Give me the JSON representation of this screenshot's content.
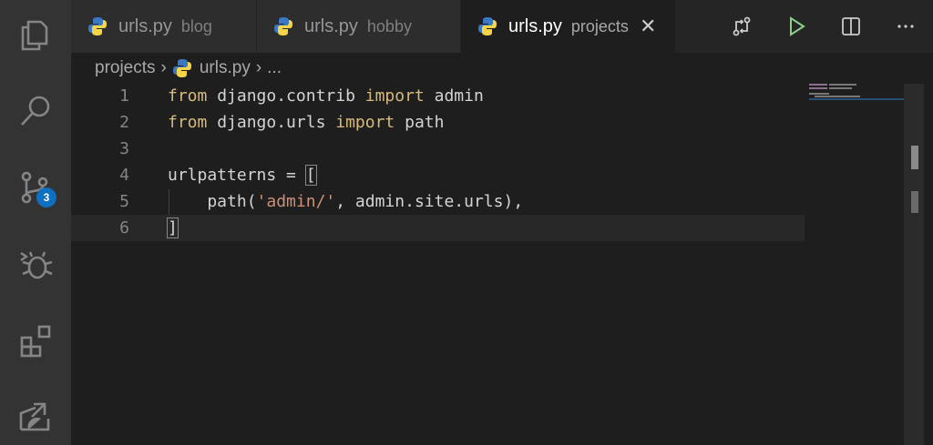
{
  "activity_bar": {
    "scm_badge": "3"
  },
  "tabs": [
    {
      "name": "urls.py",
      "desc": "blog"
    },
    {
      "name": "urls.py",
      "desc": "hobby"
    },
    {
      "name": "urls.py",
      "desc": "projects"
    }
  ],
  "breadcrumb": {
    "folder": "projects",
    "file": "urls.py",
    "ellipsis": "..."
  },
  "editor": {
    "lines": [
      {
        "num": "1"
      },
      {
        "num": "2"
      },
      {
        "num": "3"
      },
      {
        "num": "4"
      },
      {
        "num": "5"
      },
      {
        "num": "6"
      }
    ],
    "tokens": {
      "from": "from",
      "import": "import",
      "mod1": " django.contrib ",
      "name1": " admin",
      "mod2": " django.urls ",
      "name2": " path",
      "urlpatterns": "urlpatterns = ",
      "open_bracket": "[",
      "path_call": "    path(",
      "admin_str": "'admin/'",
      "rest5": ", admin.site.urls),",
      "close_bracket": "]"
    }
  },
  "colors": {
    "keyword": "#c586c0",
    "string": "#ce9178",
    "accent_badge": "#0e70c0"
  }
}
